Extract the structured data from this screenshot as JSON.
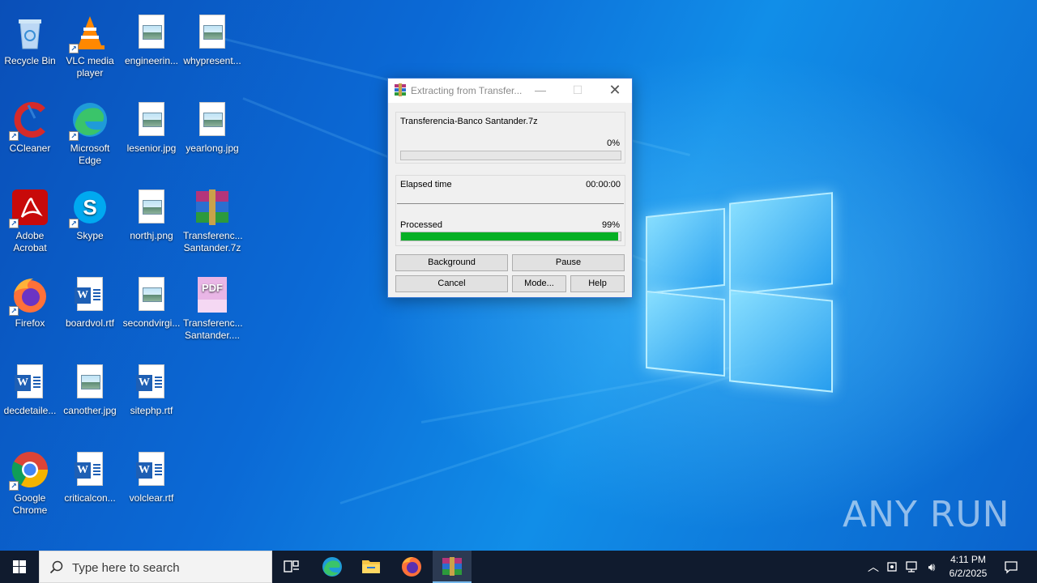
{
  "desktop": {
    "icons": [
      {
        "label": "Recycle Bin",
        "icon": "recycle-bin-icon"
      },
      {
        "label": "VLC media player",
        "icon": "vlc-icon"
      },
      {
        "label": "engineerin...",
        "icon": "image-file-icon"
      },
      {
        "label": "whypresent...",
        "icon": "image-file-icon"
      },
      {
        "label": "CCleaner",
        "icon": "ccleaner-icon"
      },
      {
        "label": "Microsoft Edge",
        "icon": "edge-icon"
      },
      {
        "label": "lesenior.jpg",
        "icon": "image-file-icon"
      },
      {
        "label": "yearlong.jpg",
        "icon": "image-file-icon"
      },
      {
        "label": "Adobe Acrobat",
        "icon": "acrobat-icon"
      },
      {
        "label": "Skype",
        "icon": "skype-icon"
      },
      {
        "label": "northj.png",
        "icon": "image-file-icon"
      },
      {
        "label": "Transferenc... Santander.7z",
        "icon": "winrar-archive-icon"
      },
      {
        "label": "Firefox",
        "icon": "firefox-icon"
      },
      {
        "label": "boardvol.rtf",
        "icon": "word-file-icon"
      },
      {
        "label": "secondvirgi...",
        "icon": "image-file-icon"
      },
      {
        "label": "Transferenc... Santander....",
        "icon": "pdf-file-icon"
      },
      {
        "label": "decdetaile...",
        "icon": "word-file-icon"
      },
      {
        "label": "canother.jpg",
        "icon": "image-file-icon"
      },
      {
        "label": "sitephp.rtf",
        "icon": "word-file-icon"
      },
      {
        "label": "Google Chrome",
        "icon": "chrome-icon"
      },
      {
        "label": "criticalcon...",
        "icon": "word-file-icon"
      },
      {
        "label": "volclear.rtf",
        "icon": "word-file-icon"
      }
    ]
  },
  "dialog": {
    "title": "Extracting from Transfer...",
    "archive_name": "Transferencia-Banco Santander.7z",
    "file_percent_label": "0%",
    "file_progress": 0,
    "elapsed_label": "Elapsed time",
    "elapsed_value": "00:00:00",
    "processed_label": "Processed",
    "processed_percent_label": "99%",
    "processed_progress": 0.99,
    "buttons": {
      "background": "Background",
      "pause": "Pause",
      "cancel": "Cancel",
      "mode": "Mode...",
      "help": "Help"
    },
    "accent_color": "#06b025"
  },
  "watermark": {
    "text": "ANY RUN"
  },
  "taskbar": {
    "search_placeholder": "Type here to search",
    "apps": [
      "task-view-icon",
      "edge-icon",
      "file-explorer-icon",
      "firefox-icon",
      "winrar-icon"
    ],
    "clock_time": "4:11 PM",
    "clock_date": "6/2/2025"
  }
}
